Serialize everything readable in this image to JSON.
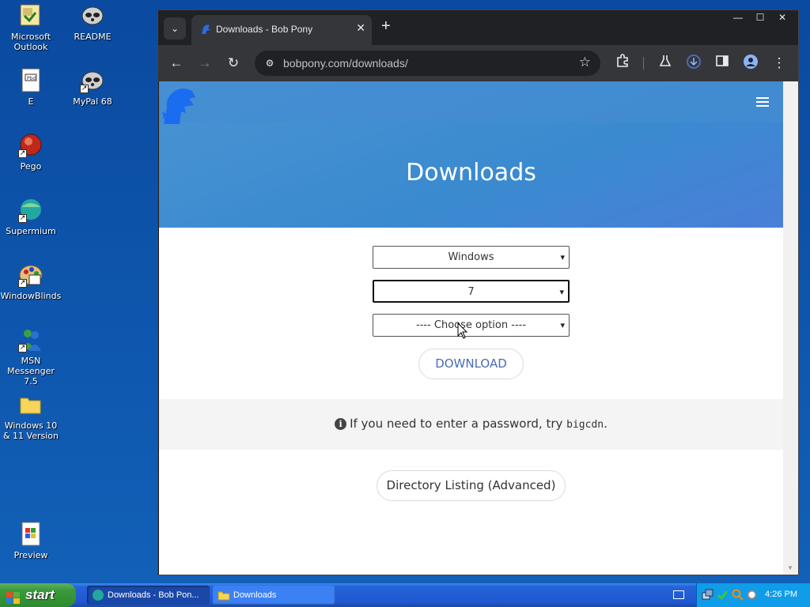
{
  "desktop": {
    "icons": [
      {
        "label": "Microsoft Outlook",
        "icon": "outlook-icon"
      },
      {
        "label": "README",
        "icon": "readme-icon"
      },
      {
        "label": "E",
        "icon": "e-file-icon"
      },
      {
        "label": "MyPal 68",
        "icon": "mypal-icon"
      },
      {
        "label": "Pego",
        "icon": "pego-icon"
      },
      {
        "label": "Supermium",
        "icon": "supermium-icon"
      },
      {
        "label": "WindowBlinds",
        "icon": "windowblinds-icon"
      },
      {
        "label": "MSN Messenger 7.5",
        "icon": "msn-icon"
      },
      {
        "label": "Windows 10 & 11 Version",
        "icon": "folder-icon"
      },
      {
        "label": "Preview",
        "icon": "preview-icon"
      }
    ]
  },
  "browser": {
    "tab_title": "Downloads - Bob Pony",
    "url": "bobpony.com/downloads/",
    "win_minimize": "—",
    "win_maximize": "☐",
    "win_close": "✕"
  },
  "page": {
    "heading": "Downloads",
    "os_select": "Windows",
    "version_select": "7",
    "option_select": "---- Choose option ----",
    "download_label": "DOWNLOAD",
    "info_prefix": "If you need to enter a password, try ",
    "info_code": "bigcdn",
    "info_suffix": ".",
    "directory_label": "Directory Listing (Advanced)"
  },
  "taskbar": {
    "start_label": "start",
    "items": [
      {
        "label": "Downloads - Bob Pon...",
        "active": true
      },
      {
        "label": "Downloads",
        "active": false
      }
    ],
    "clock": "4:26 PM"
  },
  "colors": {
    "hero_blue": "#3a8ad0",
    "link_blue": "#4a6cb5",
    "desktop_blue": "#0a4aa0",
    "taskbar_blue": "#1f58cf",
    "start_green": "#3a9a3a"
  }
}
